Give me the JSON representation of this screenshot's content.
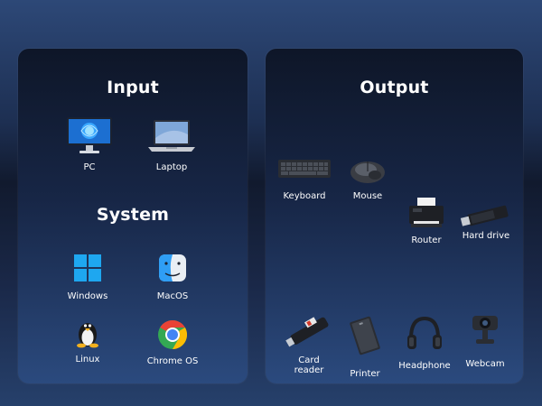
{
  "input": {
    "title": "Input",
    "items": [
      {
        "label": "PC",
        "icon": "desktop-pc-icon"
      },
      {
        "label": "Laptop",
        "icon": "laptop-icon"
      }
    ]
  },
  "system": {
    "title": "System",
    "items": [
      {
        "label": "Windows",
        "icon": "windows-logo-icon"
      },
      {
        "label": "MacOS",
        "icon": "macos-finder-icon"
      },
      {
        "label": "Linux",
        "icon": "linux-tux-icon"
      },
      {
        "label": "Chrome OS",
        "icon": "chrome-logo-icon"
      }
    ]
  },
  "output": {
    "title": "Output",
    "items": [
      {
        "label": "Keyboard",
        "icon": "keyboard-icon"
      },
      {
        "label": "Mouse",
        "icon": "mouse-icon"
      },
      {
        "label": "Router",
        "icon": "router-printer-icon"
      },
      {
        "label": "Hard drive",
        "icon": "usb-drive-icon"
      },
      {
        "label": "Card reader",
        "icon": "card-reader-icon"
      },
      {
        "label": "Printer",
        "icon": "external-drive-icon"
      },
      {
        "label": "Headphone",
        "icon": "headphones-icon"
      },
      {
        "label": "Webcam",
        "icon": "webcam-icon"
      }
    ]
  },
  "colors": {
    "windows_blue": "#1ea7f0",
    "chrome_red": "#e94235",
    "chrome_yellow": "#fbbc04",
    "chrome_green": "#34a853",
    "chrome_blue": "#4285f4"
  }
}
